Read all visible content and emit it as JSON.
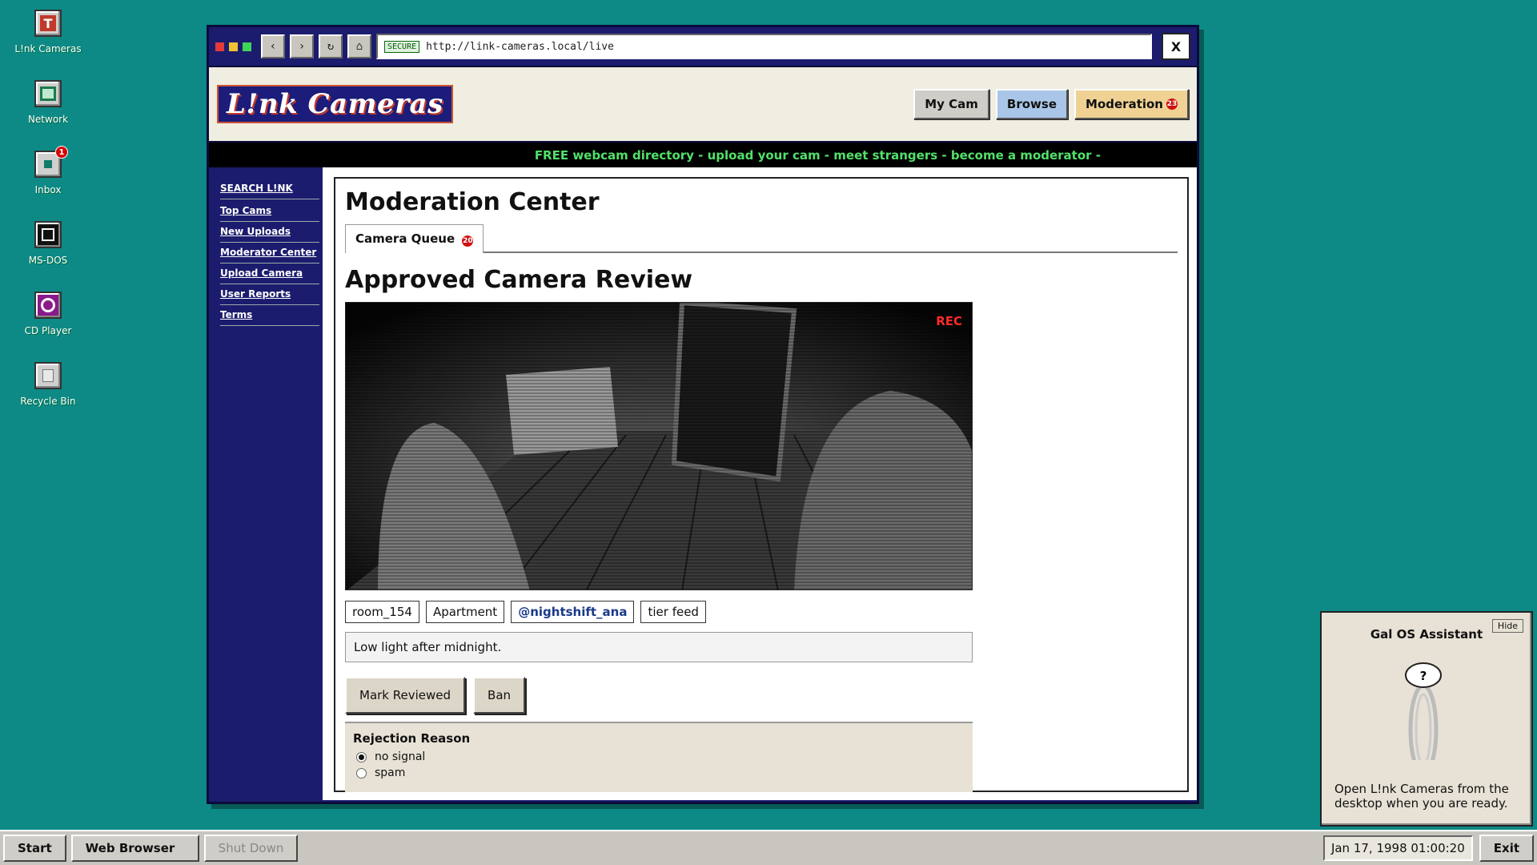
{
  "desktop": {
    "icons": [
      {
        "label": "L!nk Cameras",
        "icon": "link-cameras-icon"
      },
      {
        "label": "Network",
        "icon": "network-icon"
      },
      {
        "label": "Inbox",
        "icon": "inbox-icon",
        "badge": "1"
      },
      {
        "label": "MS-DOS",
        "icon": "msdos-icon"
      },
      {
        "label": "CD Player",
        "icon": "cd-player-icon"
      },
      {
        "label": "Recycle Bin",
        "icon": "recycle-bin-icon"
      }
    ]
  },
  "browser": {
    "secure_label": "SECURE",
    "url": "http://link-cameras.local/live",
    "close_label": "X",
    "dot_colors": [
      "#e33b3b",
      "#f2c230",
      "#3fd45a"
    ]
  },
  "site": {
    "logo": "L!nk Cameras",
    "nav": {
      "my_cam": "My Cam",
      "browse": "Browse",
      "moderation": "Moderation",
      "moderation_count": "23"
    },
    "ticker": "FREE webcam directory - upload your cam - meet strangers - become a moderator -",
    "sidebar": [
      "SEARCH L!NK",
      "Top Cams",
      "New Uploads",
      "Moderator Center",
      "Upload Camera",
      "User Reports",
      "Terms"
    ]
  },
  "moderation": {
    "title": "Moderation Center",
    "tab_label": "Camera Queue",
    "tab_count": "20",
    "review_title": "Approved Camera Review",
    "rec_label": "REC",
    "tags": {
      "room": "room_154",
      "category": "Apartment",
      "user": "@nightshift_ana",
      "tier": "tier feed"
    },
    "note": "Low light after midnight.",
    "mark_reviewed": "Mark Reviewed",
    "ban": "Ban",
    "rejection_title": "Rejection Reason",
    "reasons": [
      {
        "label": "no signal",
        "selected": true
      },
      {
        "label": "spam",
        "selected": false
      }
    ]
  },
  "assistant": {
    "hide": "Hide",
    "title": "Gal OS Assistant",
    "bubble": "?",
    "message": "Open L!nk Cameras from the desktop when you are ready."
  },
  "taskbar": {
    "start": "Start",
    "web_browser": "Web Browser",
    "shut_down": "Shut Down",
    "clock": "Jan 17, 1998 01:00:20",
    "exit": "Exit"
  }
}
